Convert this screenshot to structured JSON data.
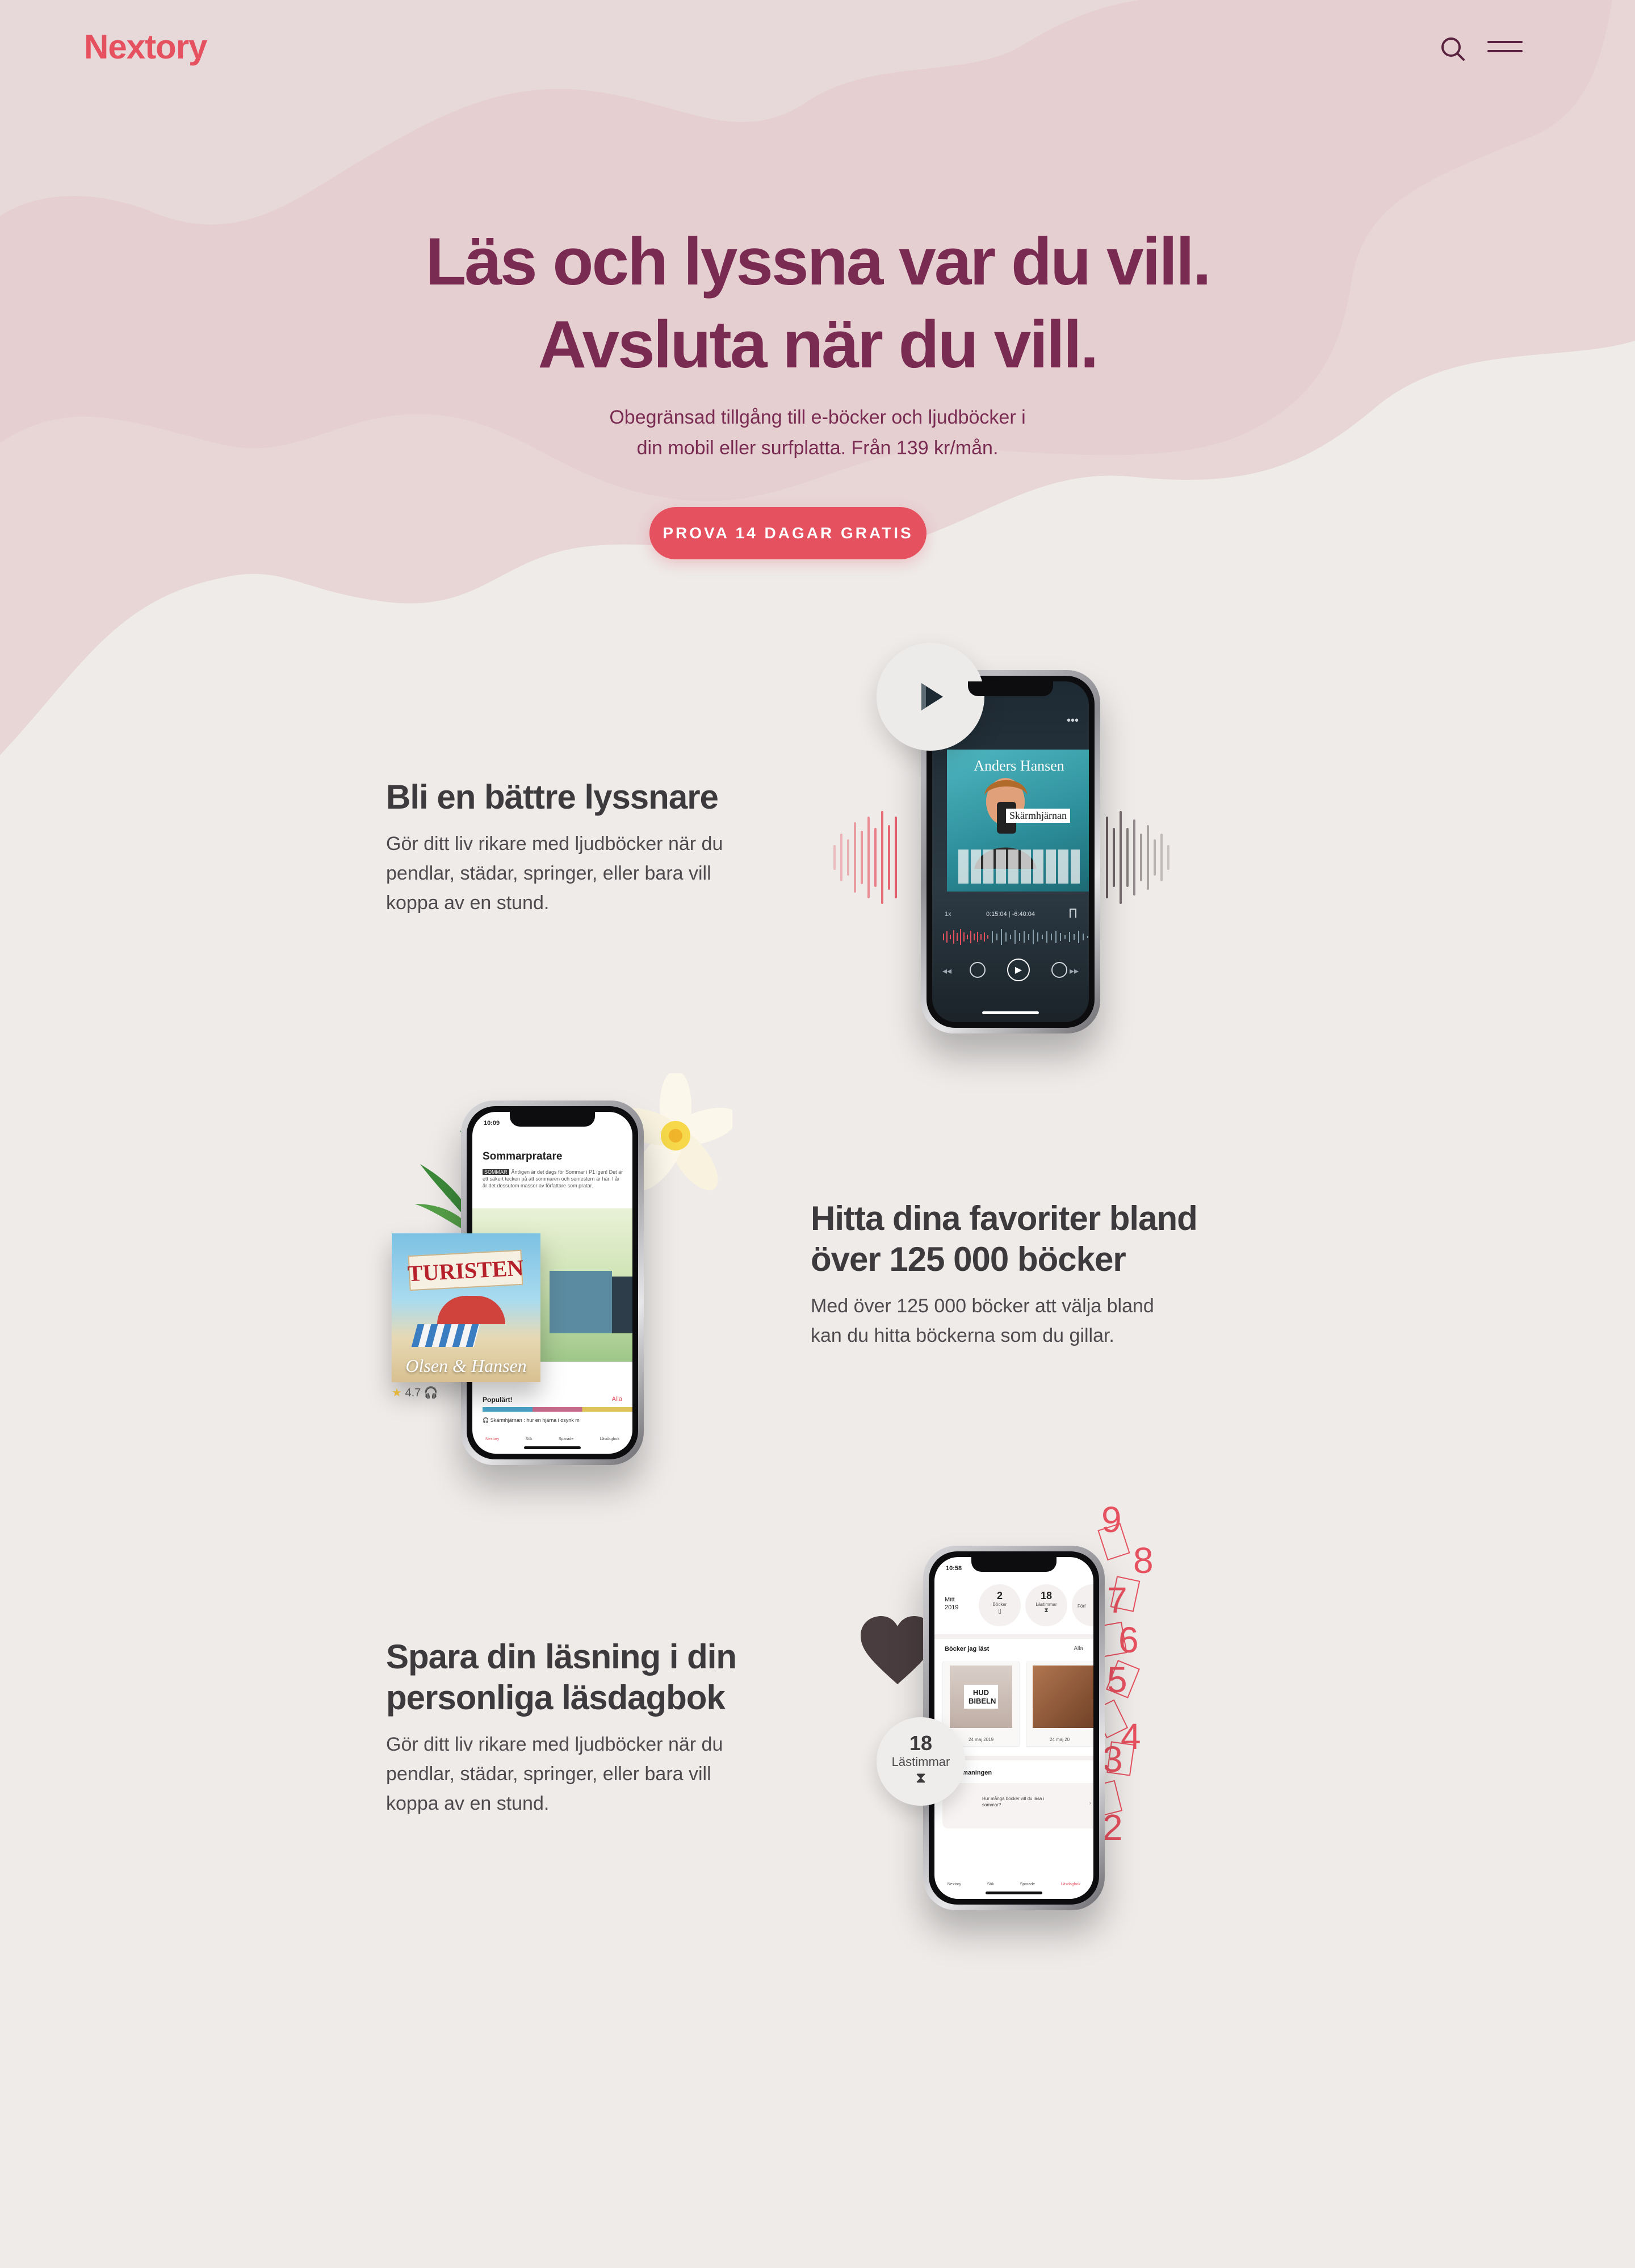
{
  "brand": {
    "logo": "Nextory",
    "accent": "#e6515f",
    "primary": "#7a2b52"
  },
  "header": {
    "search_icon": "search-icon",
    "menu_icon": "hamburger-menu-icon"
  },
  "hero": {
    "title_line1": "Läs och lyssna var du vill.",
    "title_line2": "Avsluta när du vill.",
    "subtitle_line1": "Obegränsad tillgång till e-böcker och ljudböcker i",
    "subtitle_line2": "din mobil eller surfplatta. Från 139 kr/mån.",
    "cta": "PROVA 14 DAGAR GRATIS"
  },
  "features": [
    {
      "title_lines": [
        "Bli en bättre lyssnare"
      ],
      "body_lines": [
        "Gör ditt liv rikare med ljudböcker när du",
        "pendlar, städar, springer, eller bara vill",
        "koppa av en stund."
      ],
      "phone": {
        "author": "Anders Hansen",
        "book": "Skärmhjärnan",
        "speed": "1x",
        "time": "0:15:04 | -6:40:04"
      }
    },
    {
      "title_lines": [
        "Hitta dina favoriter bland",
        "över 125 000 böcker"
      ],
      "body_lines": [
        "Med över 125 000 böcker att välja bland",
        "kan du hitta böckerna som du gillar."
      ],
      "phone": {
        "time": "10:09",
        "section_title": "Sommarpratare",
        "tag": "SOMMAR",
        "teaser": "Äntligen är det dags för Sommar i P1 igen! Det är ett säkert tecken på att sommaren och semestern är här. I år är det dessutom massor av författare som pratar.",
        "cover_title": "TURISTEN",
        "cover_authors": "Olsen & Hansen",
        "rating": "4.7",
        "popular": "Populärt!",
        "all_link": "Alla",
        "now_playing": "Skärmhjärnan : hur en hjärna i osynk m",
        "nav": [
          "Nextory",
          "Sök",
          "Sparade",
          "Läsdagbok"
        ]
      }
    },
    {
      "title_lines": [
        "Spara din läsning i din",
        "personliga läsdagbok"
      ],
      "body_lines": [
        "Gör ditt liv rikare med ljudböcker när du",
        "pendlar, städar, springer, eller bara vill",
        "koppa av en stund."
      ],
      "phone": {
        "time": "10:58",
        "year_label": "Mitt",
        "year": "2019",
        "stat1_value": "2",
        "stat1_label": "Böcker",
        "stat2_value": "18",
        "stat2_label": "Lästimmar",
        "stat3_label": "Förf",
        "read_books": "Böcker jag läst",
        "all_link": "Alla",
        "book1": "HUD BIBELN",
        "book1_date": "24 maj 2019",
        "book2_date": "24 maj 20",
        "challenge": "Bokutmaningen",
        "challenge_text": "Hur många böcker vill du läsa i sommar?",
        "nav": [
          "Nextory",
          "Sök",
          "Sparade",
          "Läsdagbok"
        ]
      },
      "badge_value": "18",
      "badge_label": "Lästimmar",
      "numbers": [
        "9",
        "8",
        "7",
        "6",
        "5",
        "4",
        "3",
        "2"
      ]
    }
  ]
}
